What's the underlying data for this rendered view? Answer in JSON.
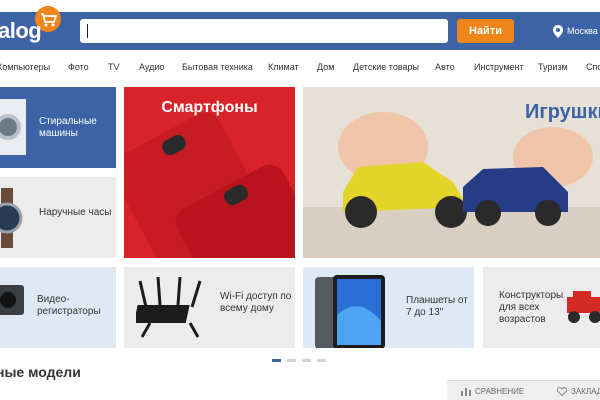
{
  "header": {
    "logo_text": "alog",
    "search_value": "",
    "find_label": "Найти",
    "city": "Москва"
  },
  "nav": {
    "items": [
      "Компьютеры",
      "Фото",
      "TV",
      "Аудио",
      "Бытовая техника",
      "Климат",
      "Дом",
      "Детские товары",
      "Авто",
      "Инструмент",
      "Туризм",
      "Спо"
    ]
  },
  "tiles": {
    "washing": "Стиральные машины",
    "watches": "Наручные часы",
    "dashcams": "Видео-регистраторы",
    "wifi": "Wi-Fi доступ по всему дому",
    "tablets": "Планшеты от 7 до 13\"",
    "constructors": "Конструкторы для всех возрастов"
  },
  "banners": {
    "smartphones": "Смартфоны",
    "toys": "Игрушки"
  },
  "carousel": {
    "pages": 4,
    "active": 1
  },
  "section": {
    "title": "ные модели"
  },
  "bottom_bar": {
    "compare": "СРАВНЕНИЕ",
    "bookmarks": "ЗАКЛАД"
  },
  "colors": {
    "brand": "#3b63a6",
    "accent": "#f0851b",
    "red_banner": "#d8232b"
  }
}
